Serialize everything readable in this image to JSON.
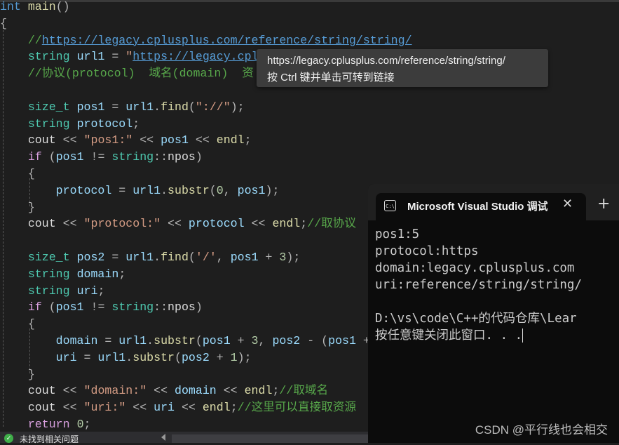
{
  "editor": {
    "lines": [
      [
        [
          "kw",
          "int"
        ],
        [
          "pl",
          " "
        ],
        [
          "fn",
          "main"
        ],
        [
          "pu",
          "()"
        ]
      ],
      [
        [
          "pu",
          "{"
        ]
      ],
      [
        [
          "pl",
          "    "
        ],
        [
          "cm",
          "//"
        ],
        [
          "lk",
          "https://legacy.cplusplus.com/reference/string/string/"
        ]
      ],
      [
        [
          "pl",
          "    "
        ],
        [
          "ty",
          "string"
        ],
        [
          "pl",
          " "
        ],
        [
          "va",
          "url1"
        ],
        [
          "pu",
          " = "
        ],
        [
          "st",
          "\""
        ],
        [
          "lk",
          "https://legacy.cplu"
        ]
      ],
      [
        [
          "pl",
          "    "
        ],
        [
          "cm",
          "//协议(protocol)  域名(domain)  资"
        ]
      ],
      [],
      [
        [
          "pl",
          "    "
        ],
        [
          "ty",
          "size_t"
        ],
        [
          "pl",
          " "
        ],
        [
          "va",
          "pos1"
        ],
        [
          "pu",
          " = "
        ],
        [
          "va",
          "url1"
        ],
        [
          "pu",
          "."
        ],
        [
          "fn",
          "find"
        ],
        [
          "pu",
          "("
        ],
        [
          "st",
          "\"://\""
        ],
        [
          "pu",
          ");"
        ]
      ],
      [
        [
          "pl",
          "    "
        ],
        [
          "ty",
          "string"
        ],
        [
          "pl",
          " "
        ],
        [
          "va",
          "protocol"
        ],
        [
          "pu",
          ";"
        ]
      ],
      [
        [
          "pl",
          "    "
        ],
        [
          "pl",
          "cout"
        ],
        [
          "pu",
          " << "
        ],
        [
          "st",
          "\"pos1:\""
        ],
        [
          "pu",
          " << "
        ],
        [
          "va",
          "pos1"
        ],
        [
          "pu",
          " << "
        ],
        [
          "fn",
          "endl"
        ],
        [
          "pu",
          ";"
        ]
      ],
      [
        [
          "pl",
          "    "
        ],
        [
          "ctl",
          "if"
        ],
        [
          "pu",
          " ("
        ],
        [
          "va",
          "pos1"
        ],
        [
          "pu",
          " != "
        ],
        [
          "ty",
          "string"
        ],
        [
          "pu",
          "::"
        ],
        [
          "pl",
          "npos"
        ],
        [
          "pu",
          ")"
        ]
      ],
      [
        [
          "pl",
          "    "
        ],
        [
          "pu",
          "{"
        ]
      ],
      [
        [
          "pl",
          "        "
        ],
        [
          "va",
          "protocol"
        ],
        [
          "pu",
          " = "
        ],
        [
          "va",
          "url1"
        ],
        [
          "pu",
          "."
        ],
        [
          "fn",
          "substr"
        ],
        [
          "pu",
          "("
        ],
        [
          "num",
          "0"
        ],
        [
          "pu",
          ", "
        ],
        [
          "va",
          "pos1"
        ],
        [
          "pu",
          ");"
        ]
      ],
      [
        [
          "pl",
          "    "
        ],
        [
          "pu",
          "}"
        ]
      ],
      [
        [
          "pl",
          "    "
        ],
        [
          "pl",
          "cout"
        ],
        [
          "pu",
          " << "
        ],
        [
          "st",
          "\"protocol:\""
        ],
        [
          "pu",
          " << "
        ],
        [
          "va",
          "protocol"
        ],
        [
          "pu",
          " << "
        ],
        [
          "fn",
          "endl"
        ],
        [
          "pu",
          ";"
        ],
        [
          "cm",
          "//取协议"
        ]
      ],
      [],
      [
        [
          "pl",
          "    "
        ],
        [
          "ty",
          "size_t"
        ],
        [
          "pl",
          " "
        ],
        [
          "va",
          "pos2"
        ],
        [
          "pu",
          " = "
        ],
        [
          "va",
          "url1"
        ],
        [
          "pu",
          "."
        ],
        [
          "fn",
          "find"
        ],
        [
          "pu",
          "("
        ],
        [
          "st",
          "'/'"
        ],
        [
          "pu",
          ", "
        ],
        [
          "va",
          "pos1"
        ],
        [
          "pu",
          " + "
        ],
        [
          "num",
          "3"
        ],
        [
          "pu",
          ");"
        ]
      ],
      [
        [
          "pl",
          "    "
        ],
        [
          "ty",
          "string"
        ],
        [
          "pl",
          " "
        ],
        [
          "va",
          "domain"
        ],
        [
          "pu",
          ";"
        ]
      ],
      [
        [
          "pl",
          "    "
        ],
        [
          "ty",
          "string"
        ],
        [
          "pl",
          " "
        ],
        [
          "va",
          "uri"
        ],
        [
          "pu",
          ";"
        ]
      ],
      [
        [
          "pl",
          "    "
        ],
        [
          "ctl",
          "if"
        ],
        [
          "pu",
          " ("
        ],
        [
          "va",
          "pos1"
        ],
        [
          "pu",
          " != "
        ],
        [
          "ty",
          "string"
        ],
        [
          "pu",
          "::"
        ],
        [
          "pl",
          "npos"
        ],
        [
          "pu",
          ")"
        ]
      ],
      [
        [
          "pl",
          "    "
        ],
        [
          "pu",
          "{"
        ]
      ],
      [
        [
          "pl",
          "        "
        ],
        [
          "va",
          "domain"
        ],
        [
          "pu",
          " = "
        ],
        [
          "va",
          "url1"
        ],
        [
          "pu",
          "."
        ],
        [
          "fn",
          "substr"
        ],
        [
          "pu",
          "("
        ],
        [
          "va",
          "pos1"
        ],
        [
          "pu",
          " + "
        ],
        [
          "num",
          "3"
        ],
        [
          "pu",
          ", "
        ],
        [
          "va",
          "pos2"
        ],
        [
          "pu",
          " - ("
        ],
        [
          "va",
          "pos1"
        ],
        [
          "pu",
          " + "
        ]
      ],
      [
        [
          "pl",
          "        "
        ],
        [
          "va",
          "uri"
        ],
        [
          "pu",
          " = "
        ],
        [
          "va",
          "url1"
        ],
        [
          "pu",
          "."
        ],
        [
          "fn",
          "substr"
        ],
        [
          "pu",
          "("
        ],
        [
          "va",
          "pos2"
        ],
        [
          "pu",
          " + "
        ],
        [
          "num",
          "1"
        ],
        [
          "pu",
          ");"
        ]
      ],
      [
        [
          "pl",
          "    "
        ],
        [
          "pu",
          "}"
        ]
      ],
      [
        [
          "pl",
          "    "
        ],
        [
          "pl",
          "cout"
        ],
        [
          "pu",
          " << "
        ],
        [
          "st",
          "\"domain:\""
        ],
        [
          "pu",
          " << "
        ],
        [
          "va",
          "domain"
        ],
        [
          "pu",
          " << "
        ],
        [
          "fn",
          "endl"
        ],
        [
          "pu",
          ";"
        ],
        [
          "cm",
          "//取域名"
        ]
      ],
      [
        [
          "pl",
          "    "
        ],
        [
          "pl",
          "cout"
        ],
        [
          "pu",
          " << "
        ],
        [
          "st",
          "\"uri:\""
        ],
        [
          "pu",
          " << "
        ],
        [
          "va",
          "uri"
        ],
        [
          "pu",
          " << "
        ],
        [
          "fn",
          "endl"
        ],
        [
          "pu",
          ";"
        ],
        [
          "cm",
          "//这里可以直接取资源"
        ]
      ],
      [
        [
          "pl",
          "    "
        ],
        [
          "ctl",
          "return"
        ],
        [
          "pl",
          " "
        ],
        [
          "num",
          "0"
        ],
        [
          "pu",
          ";"
        ]
      ]
    ]
  },
  "tooltip": {
    "url": "https://legacy.cplusplus.com/reference/string/string/",
    "hint": "按 Ctrl 键并单击可转到链接"
  },
  "status": {
    "icon": "check-circle-icon",
    "message": "未找到相关问题",
    "ok_color": "#3fae49"
  },
  "console": {
    "tab_title": "Microsoft Visual Studio 调试控制台",
    "tab_icon": "C:\\",
    "close": "✕",
    "new_tab": "+",
    "output": [
      "pos1:5",
      "protocol:https",
      "domain:legacy.cplusplus.com",
      "uri:reference/string/string/",
      "",
      "D:\\vs\\code\\C++的代码仓库\\Lear",
      "按任意键关闭此窗口. . ."
    ]
  },
  "watermark": "CSDN @平行线也会相交"
}
